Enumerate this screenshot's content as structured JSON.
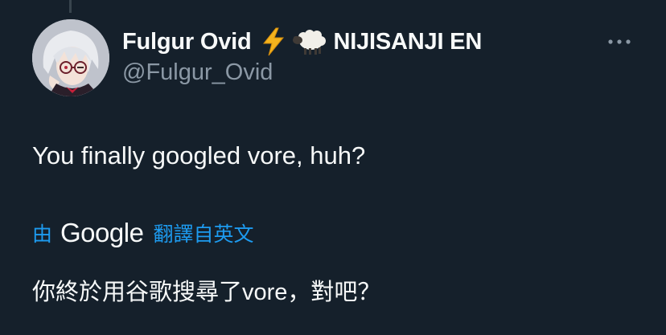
{
  "author": {
    "display_name": "Fulgur Ovid",
    "org_name": "NIJISANJI EN",
    "handle": "@Fulgur_Ovid",
    "badges": [
      "lightning-bolt-icon",
      "sheep-icon"
    ]
  },
  "tweet": {
    "text": "You finally googled vore, huh?"
  },
  "translation": {
    "by_label": "由",
    "provider": "Google",
    "from_label": "翻譯自英文",
    "text": "你終於用谷歌搜尋了vore，對吧？"
  },
  "colors": {
    "background": "#15202b",
    "primary_text": "#f7f9f9",
    "secondary_text": "#8b98a5",
    "link": "#1d9bf0"
  }
}
